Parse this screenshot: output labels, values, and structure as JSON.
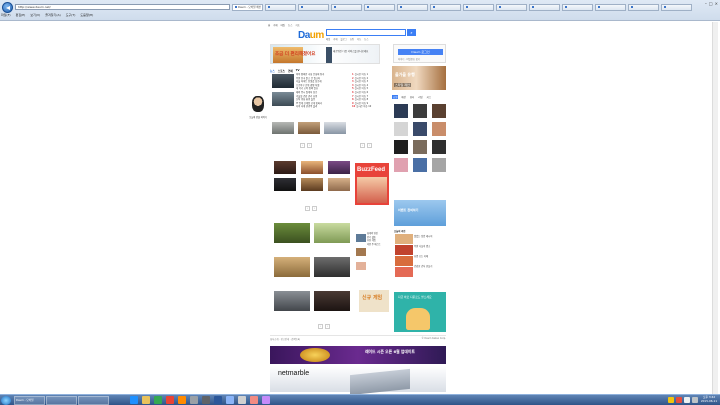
{
  "browser": {
    "address": "http://www.daum.net/",
    "tabs": [
      "Daum - 모바일 메인",
      "",
      "",
      "",
      "",
      "",
      "",
      "",
      "",
      "",
      "",
      "",
      "",
      ""
    ],
    "menu": [
      "파일(F)",
      "편집(E)",
      "보기(V)",
      "즐겨찾기(A)",
      "도구(T)",
      "도움말(H)"
    ]
  },
  "page": {
    "topnav": [
      "홈",
      "카페",
      "메일",
      "뉴스",
      "지도"
    ],
    "logo_main": "Da",
    "logo_accent": "um",
    "sublinks": [
      "메일",
      "카페",
      "블로그",
      "쇼핑",
      "지도",
      "뉴스"
    ],
    "banner": {
      "headline": "조금 더 편리해졌어요",
      "side_text": "새로워진 다음 서비스를 만나보세요"
    },
    "login": {
      "button": "Daum 로그인",
      "sub": "아이디 · 비밀번호 찾기"
    },
    "section_tabs": [
      "뉴스",
      "스포츠",
      "연예",
      "TV"
    ],
    "news_items": [
      "여야 합의안 국회 본회의 통과",
      "주말 전국 맑고 큰 일교차",
      "서울 아파트 전셋값 상승세",
      "프로야구 순위 경쟁 치열",
      "새 학기 교육 정책 발표",
      "해외 증시 일제히 상승",
      "겨울철 건강 관리 요령",
      "신작 영화 흥행 돌풍",
      "IT 업계 신제품 공개 잇따라",
      "지역 축제 관광객 몰려"
    ],
    "rank_items": [
      "실시간 이슈 1",
      "실시간 이슈 2",
      "실시간 이슈 3",
      "실시간 이슈 4",
      "실시간 이슈 5",
      "실시간 이슈 6",
      "실시간 이슈 7",
      "실시간 이슈 8",
      "실시간 이슈 9",
      "실시간 이슈 10"
    ],
    "celeb_caption": "오늘의 인물 이야기",
    "fashion": {
      "caption": "올가을 유행",
      "caption2": "스타일 제안"
    },
    "right_tabs": [
      "쇼핑",
      "패션",
      "뷰티",
      "리빙",
      "키즈"
    ],
    "buzz_title": "BuzzFeed",
    "sidebar_ad1": "이벤트 참여하기",
    "right_news_head": "오늘의 추천",
    "right_news": [
      "맛있는 집밥 레시피",
      "주말 나들이 명소",
      "요즘 뜨는 카페",
      "건강한 간식 만들기"
    ],
    "mid_list": [
      "화제의 영상",
      "인기 웹툰",
      "추천 게임",
      "이번 주 베스트"
    ],
    "game_title": "신규 게임",
    "sidebar_ad2": "지금 바로 다운로드 받으세요",
    "footer_left": "회사소개 · 광고안내 · 검색등록",
    "footer_right": "© Daum Kakao Corp.",
    "purple_banner": "레이드 시즌 오픈 6월 업데이트",
    "netmarble": "netmarble"
  },
  "taskbar": {
    "items": [
      "Daum - 모바일",
      "",
      "",
      ""
    ],
    "clock_time": "오후 3:42",
    "clock_date": "2015-06-11"
  }
}
